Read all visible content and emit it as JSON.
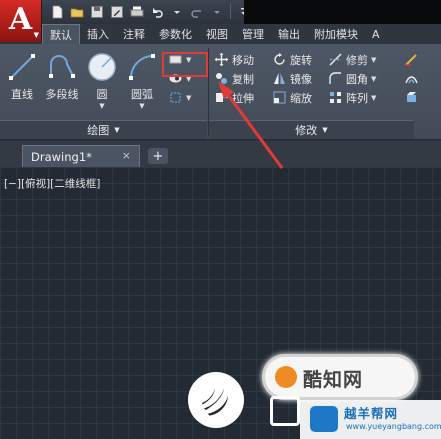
{
  "app": {
    "logo_letter": "A"
  },
  "ribbon_tabs": [
    "默认",
    "插入",
    "注释",
    "参数化",
    "视图",
    "管理",
    "输出",
    "附加模块",
    "A"
  ],
  "draw_panel": {
    "title": "绘图",
    "tools": [
      {
        "label": "直线"
      },
      {
        "label": "多段线"
      },
      {
        "label": "圆"
      },
      {
        "label": "圆弧"
      }
    ]
  },
  "modify_panel": {
    "title": "修改",
    "rows": [
      [
        "移动",
        "旋转",
        "修剪"
      ],
      [
        "复制",
        "镜像",
        "圆角"
      ],
      [
        "拉伸",
        "缩放",
        "阵列"
      ]
    ]
  },
  "file_tab": {
    "name": "Drawing1*",
    "close": "×",
    "new_tab": "+"
  },
  "viewport_label": "[−][俯视][二维线框]",
  "watermark": {
    "brand_text": "酷知网",
    "site_name": "越羊帮网",
    "site_url": "www.yueyangbang.com"
  },
  "colors": {
    "accent_red": "#d62a26",
    "highlight_box": "#e23a36",
    "ribbon_bg": "#4e5765",
    "canvas_bg": "#232a34"
  }
}
